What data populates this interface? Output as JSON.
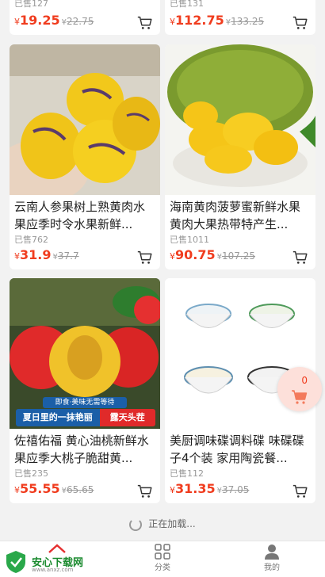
{
  "top_row": [
    {
      "sold": "已售127",
      "currency": "¥",
      "price": "19.25",
      "old_currency": "¥",
      "old_price": "22.75"
    },
    {
      "sold": "已售131",
      "currency": "¥",
      "price": "112.75",
      "old_currency": "¥",
      "old_price": "133.25"
    }
  ],
  "products": [
    {
      "title": "云南人参果树上熟黄肉水果应季时令水果新鲜...",
      "sold": "已售762",
      "currency": "¥",
      "price": "31.9",
      "old_currency": "¥",
      "old_price": "37.7"
    },
    {
      "title": "海南黄肉菠萝蜜新鲜水果黄肉大果热带特产生...",
      "sold": "已售1011",
      "currency": "¥",
      "price": "90.75",
      "old_currency": "¥",
      "old_price": "107.25"
    },
    {
      "title": "佐禧佑福 黄心油桃新鲜水果应季大桃子脆甜黄...",
      "sold": "已售235",
      "currency": "¥",
      "price": "55.55",
      "old_currency": "¥",
      "old_price": "65.65",
      "banner_top": "即食·美味无需等待",
      "banner_left": "夏日里的一抹艳丽",
      "banner_right": "露天头茬"
    },
    {
      "title": "美厨调味碟调料碟 味碟碟子4个装 家用陶瓷餐...",
      "sold": "已售112",
      "currency": "¥",
      "price": "31.35",
      "old_currency": "¥",
      "old_price": "37.05"
    }
  ],
  "loading_text": "正在加载...",
  "float_cart": {
    "count": "0"
  },
  "tabbar": {
    "logo_text": "安心下载网",
    "logo_sub": "www.anxz.com",
    "category_label": "分类",
    "mine_label": "我的"
  },
  "colors": {
    "price": "#f03c1e",
    "accent_green": "#1a8a2e"
  }
}
